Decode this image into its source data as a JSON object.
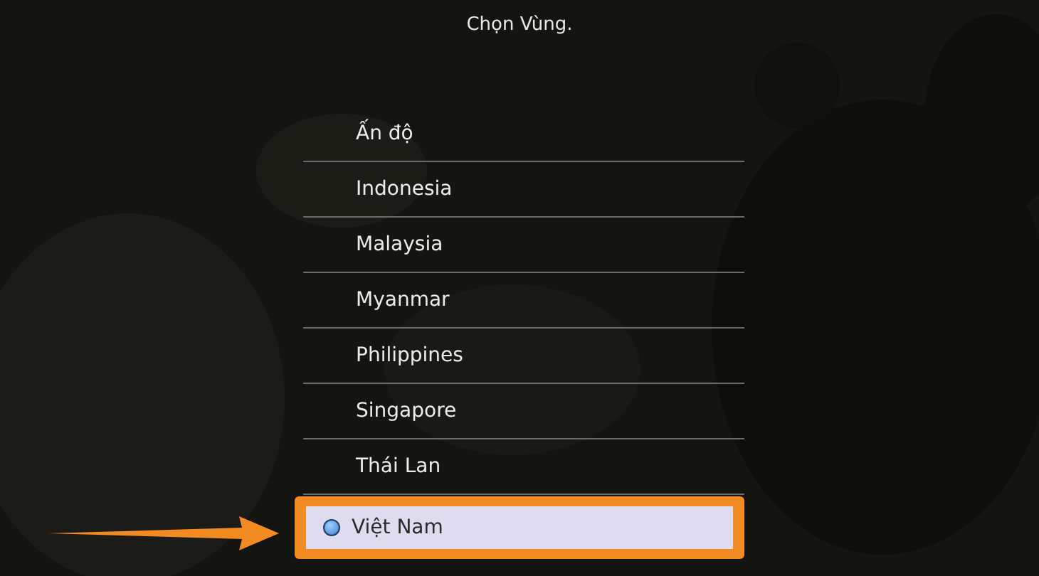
{
  "title": "Chọn Vùng.",
  "regions": [
    {
      "name": "Ấn độ",
      "selected": false
    },
    {
      "name": "Indonesia",
      "selected": false
    },
    {
      "name": "Malaysia",
      "selected": false
    },
    {
      "name": "Myanmar",
      "selected": false
    },
    {
      "name": "Philippines",
      "selected": false
    },
    {
      "name": "Singapore",
      "selected": false
    },
    {
      "name": "Thái Lan",
      "selected": false
    },
    {
      "name": "Việt Nam",
      "selected": true
    }
  ]
}
